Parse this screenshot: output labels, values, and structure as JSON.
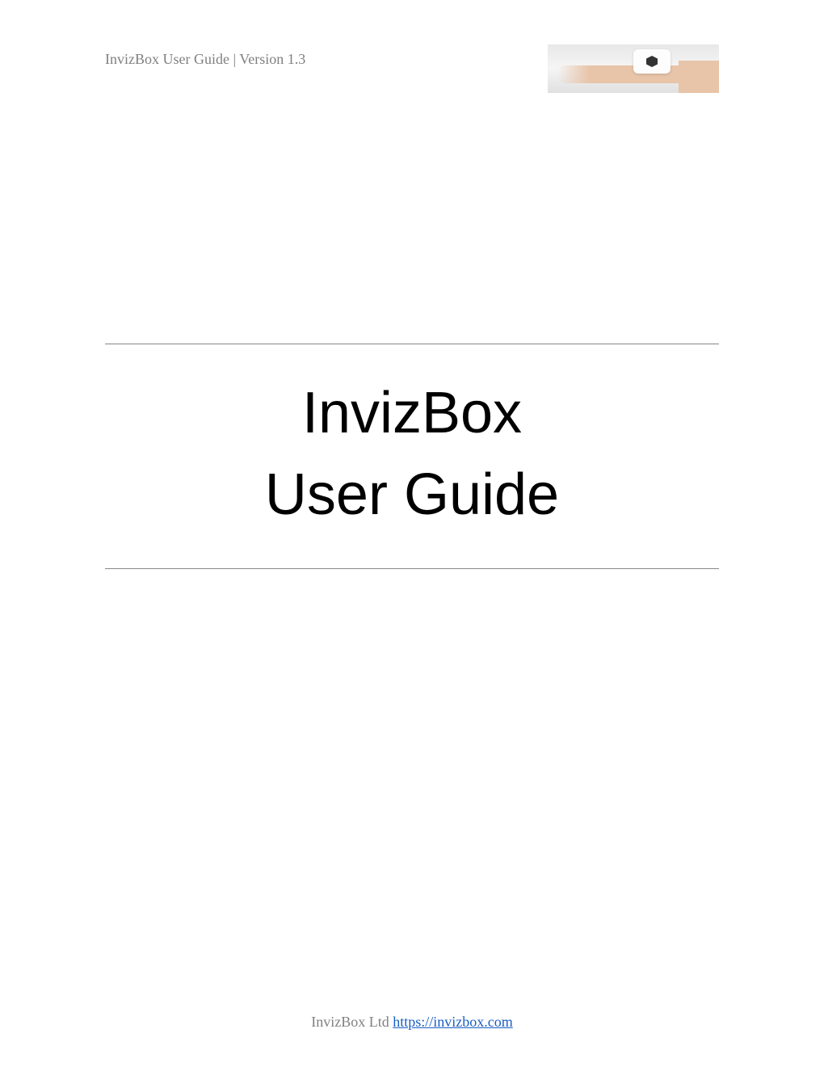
{
  "header": {
    "text": "InvizBox User Guide | Version 1.3"
  },
  "title": {
    "line1": "InvizBox",
    "line2": "User Guide"
  },
  "footer": {
    "company": "InvizBox Ltd ",
    "link_text": "https://invizbox.com",
    "link_href": "https://invizbox.com"
  }
}
